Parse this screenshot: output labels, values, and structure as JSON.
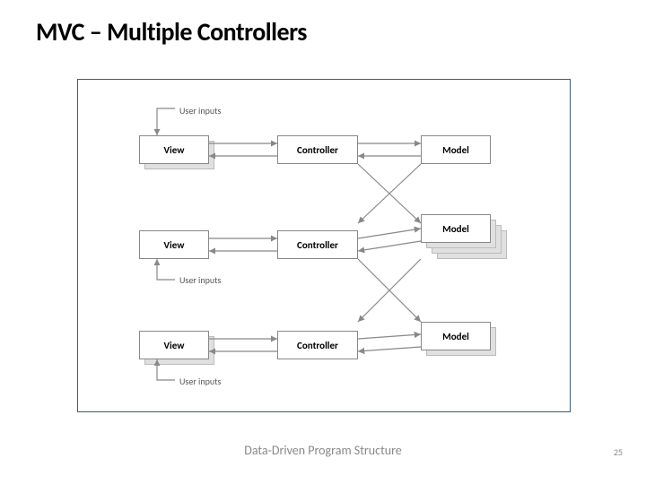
{
  "title": "MVC – Multiple Controllers",
  "footer": "Data-Driven Program Structure",
  "page_number": "25",
  "labels": {
    "user_inputs_1": "User inputs",
    "user_inputs_2": "User inputs",
    "user_inputs_3": "User inputs",
    "view": "View",
    "controller": "Controller",
    "model": "Model"
  },
  "diagram": {
    "description": "Three rows, each showing View ↔ Controller ↔ Model flow. Some View and Model boxes are stacked to indicate multiplicity. 'User inputs' labels feed into each row's View/Controller loop.",
    "rows": [
      {
        "view_stacked": true,
        "model_stacked": false,
        "model_multi_stack": false
      },
      {
        "view_stacked": false,
        "model_stacked": true,
        "model_multi_stack": true
      },
      {
        "view_stacked": true,
        "model_stacked": true,
        "model_multi_stack": false
      }
    ],
    "flows": [
      "User inputs → View",
      "View → Controller (bidirectional)",
      "Controller → Model (bidirectional)"
    ]
  }
}
